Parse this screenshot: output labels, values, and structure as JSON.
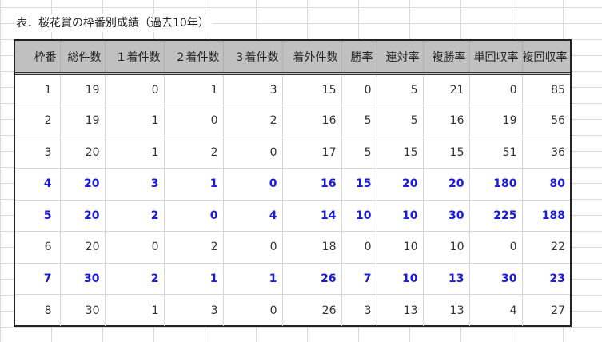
{
  "caption": "表．桜花賞の枠番別成績（過去10年）",
  "colors": {
    "header_bg": "#c0c0c0",
    "highlight_text": "#1a1adb",
    "normal_text": "#333333",
    "grid_line": "#d9d9d9"
  },
  "table": {
    "headers": [
      "枠番",
      "総件数",
      "１着件数",
      "２着件数",
      "３着件数",
      "着外件数",
      "勝率",
      "連対率",
      "複勝率",
      "単回収率",
      "複回収率"
    ],
    "rows": [
      {
        "highlight": false,
        "cells": [
          "1",
          "19",
          "0",
          "1",
          "3",
          "15",
          "0",
          "5",
          "21",
          "0",
          "85"
        ]
      },
      {
        "highlight": false,
        "cells": [
          "2",
          "19",
          "1",
          "0",
          "2",
          "16",
          "5",
          "5",
          "16",
          "19",
          "56"
        ]
      },
      {
        "highlight": false,
        "cells": [
          "3",
          "20",
          "1",
          "2",
          "0",
          "17",
          "5",
          "15",
          "15",
          "51",
          "36"
        ]
      },
      {
        "highlight": true,
        "cells": [
          "4",
          "20",
          "3",
          "1",
          "0",
          "16",
          "15",
          "20",
          "20",
          "180",
          "80"
        ]
      },
      {
        "highlight": true,
        "cells": [
          "5",
          "20",
          "2",
          "0",
          "4",
          "14",
          "10",
          "10",
          "30",
          "225",
          "188"
        ]
      },
      {
        "highlight": false,
        "cells": [
          "6",
          "20",
          "0",
          "2",
          "0",
          "18",
          "0",
          "10",
          "10",
          "0",
          "22"
        ]
      },
      {
        "highlight": true,
        "cells": [
          "7",
          "30",
          "2",
          "1",
          "1",
          "26",
          "7",
          "10",
          "13",
          "30",
          "23"
        ]
      },
      {
        "highlight": false,
        "cells": [
          "8",
          "30",
          "1",
          "3",
          "0",
          "26",
          "3",
          "13",
          "13",
          "4",
          "27"
        ]
      }
    ]
  }
}
